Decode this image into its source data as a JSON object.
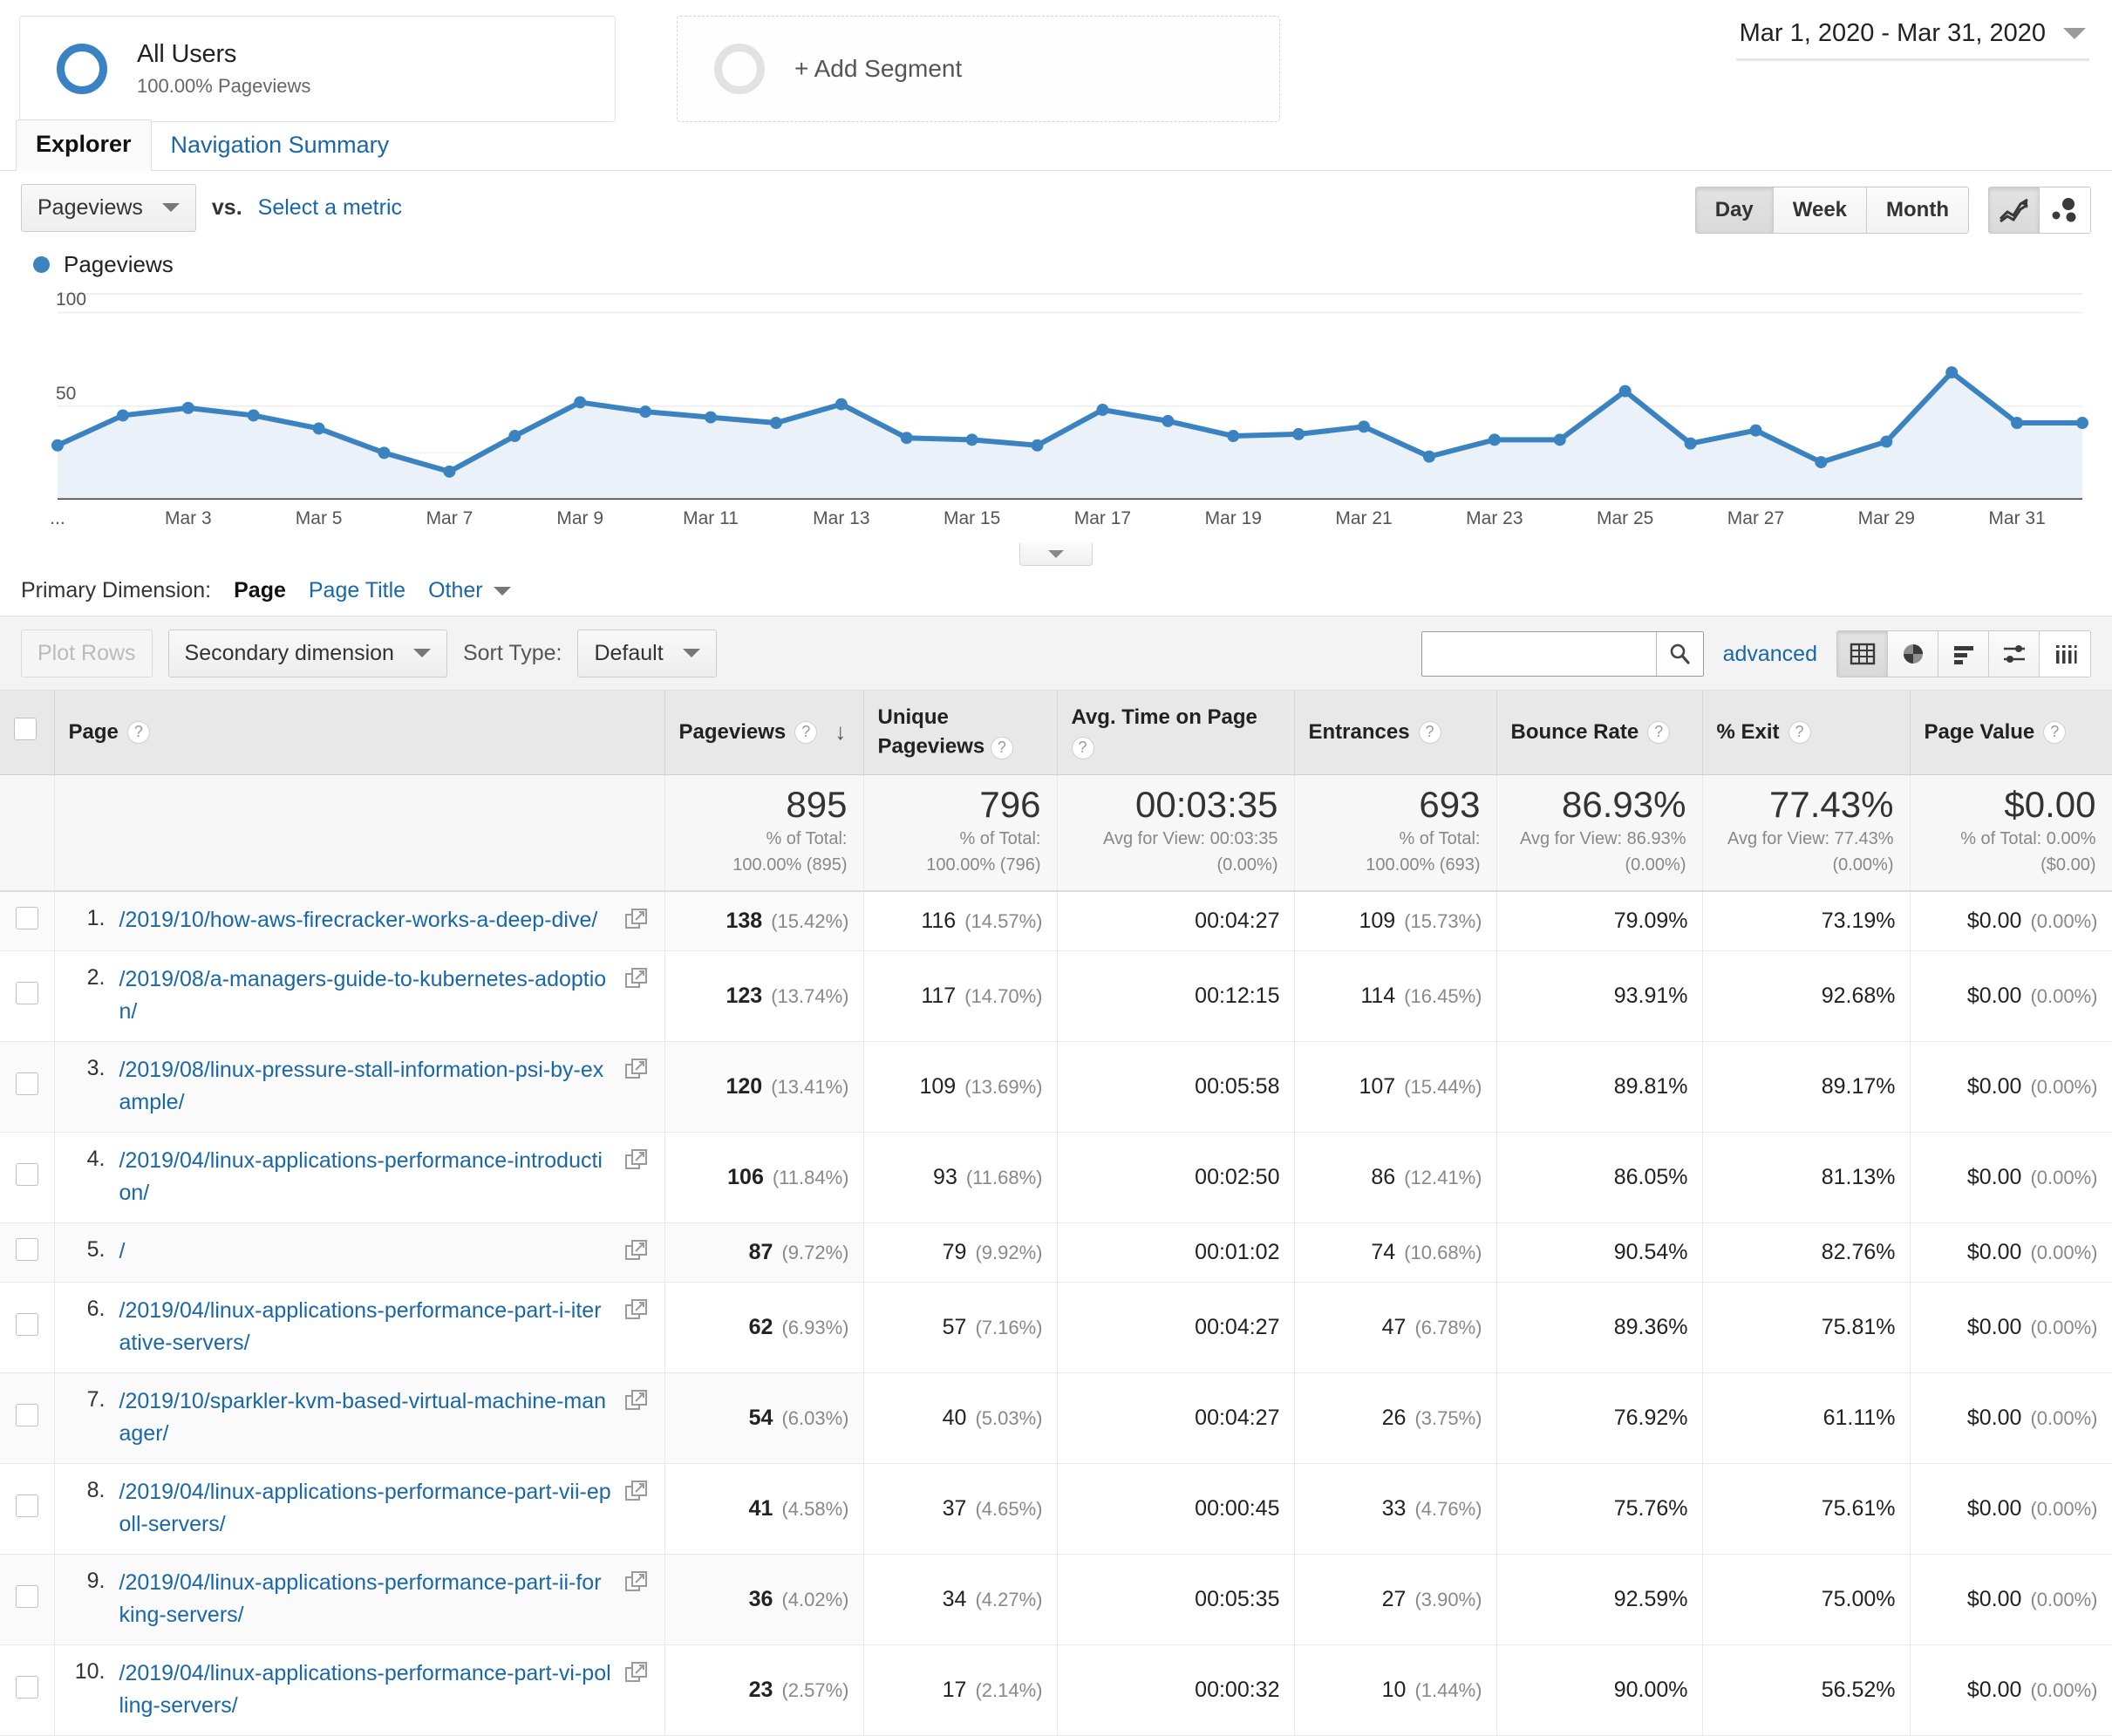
{
  "segments": {
    "all_users": {
      "title": "All Users",
      "subtitle": "100.00% Pageviews"
    },
    "add_segment": {
      "label": "+ Add Segment"
    }
  },
  "date_range": {
    "text": "Mar 1, 2020 - Mar 31, 2020"
  },
  "tabs": [
    {
      "label": "Explorer",
      "active": true
    },
    {
      "label": "Navigation Summary",
      "active": false
    }
  ],
  "metric_controls": {
    "metric_selected": "Pageviews",
    "vs_label": "vs.",
    "select_metric_link": "Select a metric",
    "granularity": [
      {
        "label": "Day",
        "selected": true
      },
      {
        "label": "Week",
        "selected": false
      },
      {
        "label": "Month",
        "selected": false
      }
    ],
    "chart_type_icons": [
      {
        "name": "line-chart-icon",
        "selected": true
      },
      {
        "name": "motion-chart-icon",
        "selected": false
      }
    ]
  },
  "legend": {
    "label": "Pageviews",
    "color": "#3b83c0"
  },
  "chart_data": {
    "type": "area",
    "title": "Pageviews",
    "xlabel": "",
    "ylabel": "",
    "ylim": [
      0,
      110
    ],
    "yticks": [
      50,
      100
    ],
    "grid": true,
    "series_name": "Pageviews",
    "line_color": "#3b83c0",
    "fill_color": "#eaf1f9",
    "x": [
      "Mar 1",
      "Mar 2",
      "Mar 3",
      "Mar 4",
      "Mar 5",
      "Mar 6",
      "Mar 7",
      "Mar 8",
      "Mar 9",
      "Mar 10",
      "Mar 11",
      "Mar 12",
      "Mar 13",
      "Mar 14",
      "Mar 15",
      "Mar 16",
      "Mar 17",
      "Mar 18",
      "Mar 19",
      "Mar 20",
      "Mar 21",
      "Mar 22",
      "Mar 23",
      "Mar 24",
      "Mar 25",
      "Mar 26",
      "Mar 27",
      "Mar 28",
      "Mar 29",
      "Mar 30",
      "Mar 31"
    ],
    "values": [
      29,
      45,
      49,
      45,
      38,
      25,
      15,
      34,
      52,
      47,
      44,
      41,
      51,
      33,
      32,
      29,
      48,
      42,
      34,
      35,
      39,
      23,
      32,
      32,
      58,
      30,
      37,
      20,
      31,
      68,
      41,
      41
    ],
    "xtick_labels": [
      "...",
      "Mar 3",
      "Mar 5",
      "Mar 7",
      "Mar 9",
      "Mar 11",
      "Mar 13",
      "Mar 15",
      "Mar 17",
      "Mar 19",
      "Mar 21",
      "Mar 23",
      "Mar 25",
      "Mar 27",
      "Mar 29",
      "Mar 31"
    ]
  },
  "primary_dimension": {
    "label": "Primary Dimension:",
    "active": "Page",
    "links": [
      "Page Title"
    ],
    "other": "Other"
  },
  "table_toolbar": {
    "plot_rows": "Plot Rows",
    "secondary_dimension": "Secondary dimension",
    "sort_type_label": "Sort Type:",
    "sort_type_value": "Default",
    "search_placeholder": "",
    "search_value": "",
    "advanced_link": "advanced",
    "view_icons": [
      {
        "name": "table-view-icon",
        "selected": true
      },
      {
        "name": "pie-chart-view-icon",
        "selected": false
      },
      {
        "name": "bar-chart-view-icon",
        "selected": false
      },
      {
        "name": "comparison-view-icon",
        "selected": false
      },
      {
        "name": "pivot-view-icon",
        "selected": false
      }
    ]
  },
  "table": {
    "columns": [
      {
        "key": "page",
        "label": "Page"
      },
      {
        "key": "pageviews",
        "label": "Pageviews",
        "sorted": "desc"
      },
      {
        "key": "unique_pageviews",
        "label": "Unique Pageviews"
      },
      {
        "key": "avg_time_on_page",
        "label": "Avg. Time on Page"
      },
      {
        "key": "entrances",
        "label": "Entrances"
      },
      {
        "key": "bounce_rate",
        "label": "Bounce Rate"
      },
      {
        "key": "exit_pct",
        "label": "% Exit"
      },
      {
        "key": "page_value",
        "label": "Page Value"
      }
    ],
    "summary": {
      "pageviews": {
        "value": "895",
        "sub1": "% of Total:",
        "sub2": "100.00% (895)"
      },
      "unique_pageviews": {
        "value": "796",
        "sub1": "% of Total:",
        "sub2": "100.00% (796)"
      },
      "avg_time_on_page": {
        "value": "00:03:35",
        "sub1": "Avg for View: 00:03:35",
        "sub2": "(0.00%)"
      },
      "entrances": {
        "value": "693",
        "sub1": "% of Total:",
        "sub2": "100.00% (693)"
      },
      "bounce_rate": {
        "value": "86.93%",
        "sub1": "Avg for View: 86.93%",
        "sub2": "(0.00%)"
      },
      "exit_pct": {
        "value": "77.43%",
        "sub1": "Avg for View: 77.43%",
        "sub2": "(0.00%)"
      },
      "page_value": {
        "value": "$0.00",
        "sub1": "% of Total: 0.00%",
        "sub2": "($0.00)"
      }
    },
    "rows": [
      {
        "index": "1.",
        "page": "/2019/10/how-aws-firecracker-works-a-deep-dive/",
        "pageviews": "138",
        "pageviews_pct": "(15.42%)",
        "unique_pageviews": "116",
        "unique_pageviews_pct": "(14.57%)",
        "avg_time_on_page": "00:04:27",
        "entrances": "109",
        "entrances_pct": "(15.73%)",
        "bounce_rate": "79.09%",
        "exit_pct": "73.19%",
        "page_value": "$0.00",
        "page_value_pct": "(0.00%)"
      },
      {
        "index": "2.",
        "page": "/2019/08/a-managers-guide-to-kubernetes-adoption/",
        "pageviews": "123",
        "pageviews_pct": "(13.74%)",
        "unique_pageviews": "117",
        "unique_pageviews_pct": "(14.70%)",
        "avg_time_on_page": "00:12:15",
        "entrances": "114",
        "entrances_pct": "(16.45%)",
        "bounce_rate": "93.91%",
        "exit_pct": "92.68%",
        "page_value": "$0.00",
        "page_value_pct": "(0.00%)"
      },
      {
        "index": "3.",
        "page": "/2019/08/linux-pressure-stall-information-psi-by-example/",
        "pageviews": "120",
        "pageviews_pct": "(13.41%)",
        "unique_pageviews": "109",
        "unique_pageviews_pct": "(13.69%)",
        "avg_time_on_page": "00:05:58",
        "entrances": "107",
        "entrances_pct": "(15.44%)",
        "bounce_rate": "89.81%",
        "exit_pct": "89.17%",
        "page_value": "$0.00",
        "page_value_pct": "(0.00%)"
      },
      {
        "index": "4.",
        "page": "/2019/04/linux-applications-performance-introduction/",
        "pageviews": "106",
        "pageviews_pct": "(11.84%)",
        "unique_pageviews": "93",
        "unique_pageviews_pct": "(11.68%)",
        "avg_time_on_page": "00:02:50",
        "entrances": "86",
        "entrances_pct": "(12.41%)",
        "bounce_rate": "86.05%",
        "exit_pct": "81.13%",
        "page_value": "$0.00",
        "page_value_pct": "(0.00%)"
      },
      {
        "index": "5.",
        "page": "/",
        "pageviews": "87",
        "pageviews_pct": "(9.72%)",
        "unique_pageviews": "79",
        "unique_pageviews_pct": "(9.92%)",
        "avg_time_on_page": "00:01:02",
        "entrances": "74",
        "entrances_pct": "(10.68%)",
        "bounce_rate": "90.54%",
        "exit_pct": "82.76%",
        "page_value": "$0.00",
        "page_value_pct": "(0.00%)"
      },
      {
        "index": "6.",
        "page": "/2019/04/linux-applications-performance-part-i-iterative-servers/",
        "pageviews": "62",
        "pageviews_pct": "(6.93%)",
        "unique_pageviews": "57",
        "unique_pageviews_pct": "(7.16%)",
        "avg_time_on_page": "00:04:27",
        "entrances": "47",
        "entrances_pct": "(6.78%)",
        "bounce_rate": "89.36%",
        "exit_pct": "75.81%",
        "page_value": "$0.00",
        "page_value_pct": "(0.00%)"
      },
      {
        "index": "7.",
        "page": "/2019/10/sparkler-kvm-based-virtual-machine-manager/",
        "pageviews": "54",
        "pageviews_pct": "(6.03%)",
        "unique_pageviews": "40",
        "unique_pageviews_pct": "(5.03%)",
        "avg_time_on_page": "00:04:27",
        "entrances": "26",
        "entrances_pct": "(3.75%)",
        "bounce_rate": "76.92%",
        "exit_pct": "61.11%",
        "page_value": "$0.00",
        "page_value_pct": "(0.00%)"
      },
      {
        "index": "8.",
        "page": "/2019/04/linux-applications-performance-part-vii-epoll-servers/",
        "pageviews": "41",
        "pageviews_pct": "(4.58%)",
        "unique_pageviews": "37",
        "unique_pageviews_pct": "(4.65%)",
        "avg_time_on_page": "00:00:45",
        "entrances": "33",
        "entrances_pct": "(4.76%)",
        "bounce_rate": "75.76%",
        "exit_pct": "75.61%",
        "page_value": "$0.00",
        "page_value_pct": "(0.00%)"
      },
      {
        "index": "9.",
        "page": "/2019/04/linux-applications-performance-part-ii-forking-servers/",
        "pageviews": "36",
        "pageviews_pct": "(4.02%)",
        "unique_pageviews": "34",
        "unique_pageviews_pct": "(4.27%)",
        "avg_time_on_page": "00:05:35",
        "entrances": "27",
        "entrances_pct": "(3.90%)",
        "bounce_rate": "92.59%",
        "exit_pct": "75.00%",
        "page_value": "$0.00",
        "page_value_pct": "(0.00%)"
      },
      {
        "index": "10.",
        "page": "/2019/04/linux-applications-performance-part-vi-polling-servers/",
        "pageviews": "23",
        "pageviews_pct": "(2.57%)",
        "unique_pageviews": "17",
        "unique_pageviews_pct": "(2.14%)",
        "avg_time_on_page": "00:00:32",
        "entrances": "10",
        "entrances_pct": "(1.44%)",
        "bounce_rate": "90.00%",
        "exit_pct": "56.52%",
        "page_value": "$0.00",
        "page_value_pct": "(0.00%)"
      }
    ]
  }
}
